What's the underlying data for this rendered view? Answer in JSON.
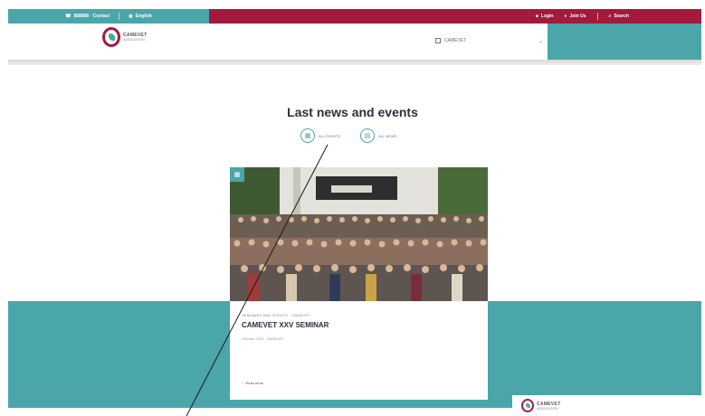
{
  "topbar": {
    "left": [
      {
        "icon": "phone-icon",
        "label": "888888 · Contact"
      },
      {
        "icon": "globe-icon",
        "label": "English"
      }
    ],
    "right": [
      {
        "icon": "lock-icon",
        "label": "Login"
      },
      {
        "icon": "user-icon",
        "label": "Join Us"
      },
      {
        "icon": "search-icon",
        "label": "Search"
      }
    ]
  },
  "header": {
    "logo_line1": "CAMEVET",
    "logo_line2": "ASSOCIATION",
    "dropdown_label": "CAMEVET",
    "dropdown_chevron": "⌄"
  },
  "main": {
    "title": "Last news and events",
    "filters": [
      {
        "icon": "calendar-icon",
        "glyph": "▦",
        "label": "ALL EVENTS"
      },
      {
        "icon": "news-icon",
        "glyph": "▤",
        "label": "ALL NEWS"
      }
    ]
  },
  "card": {
    "tag_glyph": "▦",
    "category": "SEMINARS AND EVENTS · CAMEVET",
    "title": "CAMEVET XXV SEMINAR",
    "date": "October 2022 · CAMEVET",
    "link_arrow": "›",
    "link_label": "Read more"
  },
  "footer_logo": {
    "line1": "CAMEVET",
    "line2": "ASSOCIATION"
  },
  "colors": {
    "teal": "#4aa6a9",
    "crimson": "#a31a3c",
    "title": "#2d2d3a"
  }
}
